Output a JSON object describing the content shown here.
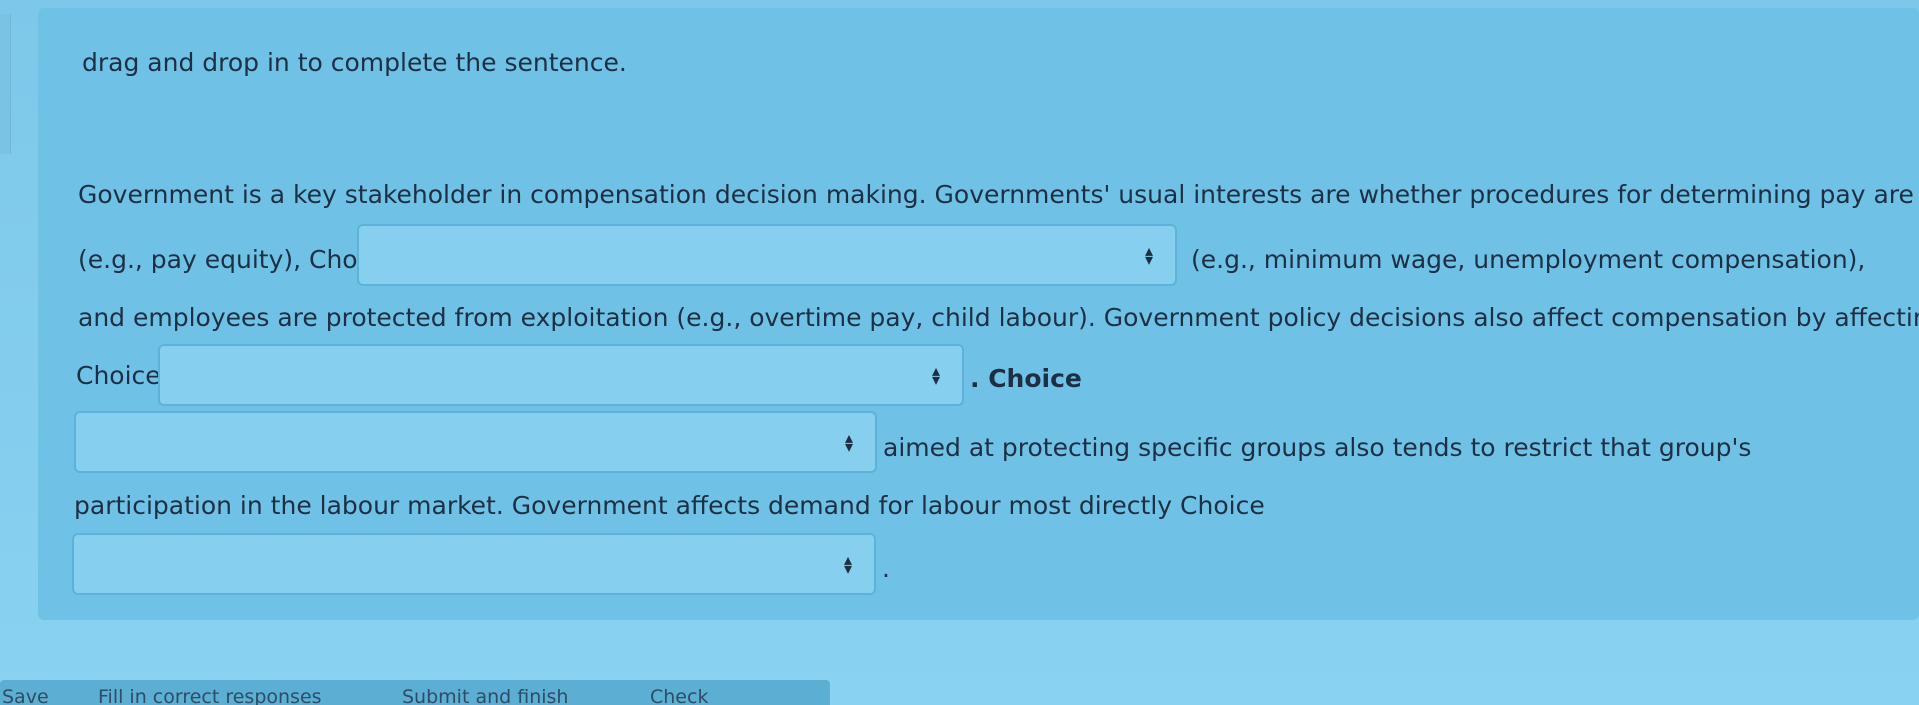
{
  "instruction": "drag and drop in to complete the sentence.",
  "question": {
    "line1": "Government is a key stakeholder in compensation decision making. Governments' usual interests are whether procedures for determining pay are fair",
    "line2_pre": "(e.g., pay equity), Choice",
    "line2_post": "(e.g., minimum wage, unemployment compensation),",
    "line3": "and employees are protected from exploitation (e.g., overtime pay, child labour). Government policy decisions also affect compensation by affecting",
    "line4_pre": "Choice",
    "line4_post": ". Choice",
    "line5_post": "aimed at protecting specific groups also tends to restrict that group's",
    "line6": "participation in the labour market. Government affects demand for labour most directly Choice",
    "line7_post": "."
  },
  "dropdowns": [
    {
      "id": "choice-1",
      "value": ""
    },
    {
      "id": "choice-2",
      "value": ""
    },
    {
      "id": "choice-3",
      "value": ""
    },
    {
      "id": "choice-4",
      "value": ""
    }
  ],
  "bottom_bar": {
    "save": "Save",
    "fill_in": "Fill in correct responses",
    "submit": "Submit and finish",
    "check": "Check"
  }
}
